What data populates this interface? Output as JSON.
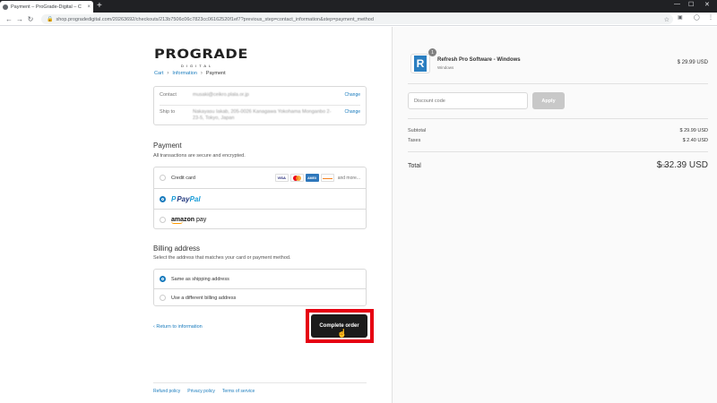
{
  "browser": {
    "tab_title": "Payment – ProGrade-Digital – C",
    "tab_close": "×",
    "new_tab": "+",
    "url": "shop.progradedigital.com/20263692/checkouts/213b7506c06c7823cc06162520f1ef7?previous_step=contact_information&step=payment_method",
    "minimize": "—",
    "maximize": "☐",
    "close": "✕",
    "back": "←",
    "forward": "→",
    "reload": "↻"
  },
  "brand": {
    "logo": "PROGRADE",
    "logo_sub": "DIGITAL"
  },
  "breadcrumbs": {
    "cart": "Cart",
    "information": "Information",
    "current": "Payment",
    "sep": "›"
  },
  "review": {
    "contact_label": "Contact",
    "contact_value": "musaki@ceikro.plala.or.jp",
    "ship_label": "Ship to",
    "ship_value": "Nakayasu Iakab, 205-0026 Kanagawa Yokohama Monganbo 2-23-5, Tokyo, Japan",
    "change": "Change"
  },
  "payment": {
    "title": "Payment",
    "subtitle": "All transactions are secure and encrypted.",
    "credit_card": "Credit card",
    "visa": "VISA",
    "amex": "AMEX",
    "and_more": "and more...",
    "paypal_mark": "P",
    "paypal_pay": "Pay",
    "paypal_pal": "Pal",
    "amazon": "amazon",
    "amazon_pay": " pay"
  },
  "billing": {
    "title": "Billing address",
    "subtitle": "Select the address that matches your card or payment method.",
    "same": "Same as shipping address",
    "different": "Use a different billing address"
  },
  "actions": {
    "return": "‹  Return to information",
    "complete": "Complete order"
  },
  "footer": {
    "refund": "Refund policy",
    "privacy": "Privacy policy",
    "terms": "Terms of service"
  },
  "summary": {
    "qty": "1",
    "product_name": "Refresh Pro Software - Windows",
    "variant": "Windows",
    "product_price": "$ 29.99 USD",
    "discount_placeholder": "Discount code",
    "apply": "Apply",
    "subtotal_label": "Subtotal",
    "subtotal_value": "$ 29.99 USD",
    "taxes_label": "Taxes",
    "taxes_value": "$ 2.40 USD",
    "total_label": "Total",
    "total_currency": "USD",
    "total_value": "$ 32.39 USD"
  },
  "colors": {
    "accent": "#197bbd",
    "highlight": "#e60012",
    "button": "#1b1b1b"
  }
}
